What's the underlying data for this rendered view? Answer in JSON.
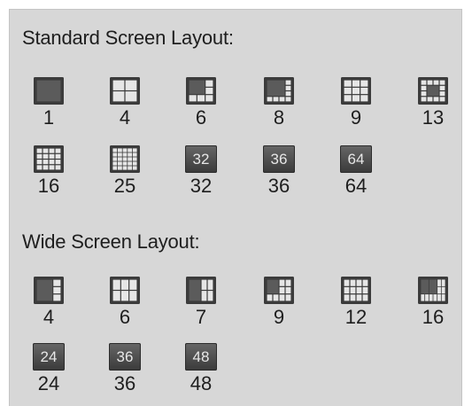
{
  "standard": {
    "title": "Standard Screen Layout:",
    "items": [
      {
        "icon": "layout-1-icon",
        "label": "1"
      },
      {
        "icon": "layout-4-icon",
        "label": "4"
      },
      {
        "icon": "layout-6-icon",
        "label": "6"
      },
      {
        "icon": "layout-8-icon",
        "label": "8"
      },
      {
        "icon": "layout-9-icon",
        "label": "9"
      },
      {
        "icon": "layout-13-icon",
        "label": "13"
      },
      {
        "icon": "layout-16-icon",
        "label": "16"
      },
      {
        "icon": "layout-25-icon",
        "label": "25"
      },
      {
        "icon": "layout-32-icon",
        "label": "32",
        "badge": "32"
      },
      {
        "icon": "layout-36-icon",
        "label": "36",
        "badge": "36"
      },
      {
        "icon": "layout-64-icon",
        "label": "64",
        "badge": "64"
      }
    ]
  },
  "wide": {
    "title": "Wide Screen Layout:",
    "items": [
      {
        "icon": "wide-layout-4-icon",
        "label": "4"
      },
      {
        "icon": "wide-layout-6-icon",
        "label": "6"
      },
      {
        "icon": "wide-layout-7-icon",
        "label": "7"
      },
      {
        "icon": "wide-layout-9-icon",
        "label": "9"
      },
      {
        "icon": "wide-layout-12-icon",
        "label": "12"
      },
      {
        "icon": "wide-layout-16-icon",
        "label": "16"
      },
      {
        "icon": "wide-layout-24-icon",
        "label": "24",
        "badge": "24"
      },
      {
        "icon": "wide-layout-36-icon",
        "label": "36",
        "badge": "36"
      },
      {
        "icon": "wide-layout-48-icon",
        "label": "48",
        "badge": "48"
      }
    ]
  },
  "colors": {
    "panel_bg": "#d7d7d7",
    "icon_dark": "#3b3b3b",
    "icon_light": "#e6e6e6",
    "text": "#1e1e1e"
  }
}
